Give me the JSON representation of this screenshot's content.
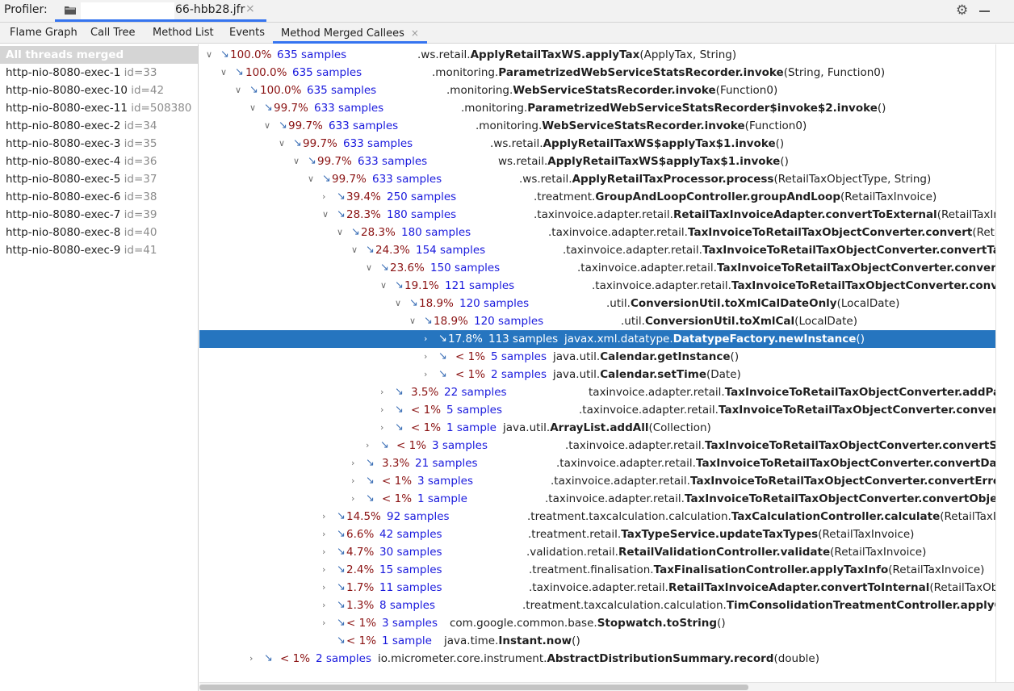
{
  "header": {
    "label": "Profiler:",
    "file_name": "66-hbb28.jfr",
    "close_glyph": "×",
    "icons": [
      "folder-icon",
      "gear-icon",
      "minimize-icon"
    ]
  },
  "tabs": [
    {
      "label": "Flame Graph"
    },
    {
      "label": "Call Tree"
    },
    {
      "label": "Method List"
    },
    {
      "label": "Events"
    },
    {
      "label": "Method Merged Callees",
      "active": true,
      "close": "×"
    }
  ],
  "threads": [
    {
      "name": "All threads merged",
      "id": ""
    },
    {
      "name": "http-nio-8080-exec-1",
      "id": "id=33"
    },
    {
      "name": "http-nio-8080-exec-10",
      "id": "id=42"
    },
    {
      "name": "http-nio-8080-exec-11",
      "id": "id=508380"
    },
    {
      "name": "http-nio-8080-exec-2",
      "id": "id=34"
    },
    {
      "name": "http-nio-8080-exec-3",
      "id": "id=35"
    },
    {
      "name": "http-nio-8080-exec-4",
      "id": "id=36"
    },
    {
      "name": "http-nio-8080-exec-5",
      "id": "id=37"
    },
    {
      "name": "http-nio-8080-exec-6",
      "id": "id=38"
    },
    {
      "name": "http-nio-8080-exec-7",
      "id": "id=39"
    },
    {
      "name": "http-nio-8080-exec-8",
      "id": "id=40"
    },
    {
      "name": "http-nio-8080-exec-9",
      "id": "id=41"
    }
  ],
  "tree": [
    {
      "pct": "100.0%",
      "samples": "635 samples",
      "cls": ".ws.retail.",
      "method": "ApplyRetailTaxWS.applyTax",
      "args": "(ApplyTax, String)"
    },
    {
      "pct": "100.0%",
      "samples": "635 samples",
      "cls": ".monitoring.",
      "method": "ParametrizedWebServiceStatsRecorder.invoke",
      "args": "(String, Function0)"
    },
    {
      "pct": "100.0%",
      "samples": "635 samples",
      "cls": ".monitoring.",
      "method": "WebServiceStatsRecorder.invoke",
      "args": "(Function0)"
    },
    {
      "pct": "99.7%",
      "samples": "633 samples",
      "cls": ".monitoring.",
      "method": "ParametrizedWebServiceStatsRecorder$invoke$2.invoke",
      "args": "()"
    },
    {
      "pct": "99.7%",
      "samples": "633 samples",
      "cls": ".monitoring.",
      "method": "WebServiceStatsRecorder.invoke",
      "args": "(Function0)"
    },
    {
      "pct": "99.7%",
      "samples": "633 samples",
      "cls": ".ws.retail.",
      "method": "ApplyRetailTaxWS$applyTax$1.invoke",
      "args": "()"
    },
    {
      "pct": "99.7%",
      "samples": "633 samples",
      "cls": "ws.retail.",
      "method": "ApplyRetailTaxWS$applyTax$1.invoke",
      "args": "()"
    },
    {
      "pct": "99.7%",
      "samples": "633 samples",
      "cls": ".ws.retail.",
      "method": "ApplyRetailTaxProcessor.process",
      "args": "(RetailTaxObjectType, String)"
    },
    {
      "pct": "39.4%",
      "samples": "250 samples",
      "cls": ".treatment.",
      "method": "GroupAndLoopController.groupAndLoop",
      "args": "(RetailTaxInvoice)"
    },
    {
      "pct": "28.3%",
      "samples": "180 samples",
      "cls": ".taxinvoice.adapter.retail.",
      "method": "RetailTaxInvoiceAdapter.convertToExternal",
      "args": "(RetailTaxInvoice)"
    },
    {
      "pct": "28.3%",
      "samples": "180 samples",
      "cls": ".taxinvoice.adapter.retail.",
      "method": "TaxInvoiceToRetailTaxObjectConverter.convert",
      "args": "(RetailTaxInvoice)"
    },
    {
      "pct": "24.3%",
      "samples": "154 samples",
      "cls": ".taxinvoice.adapter.retail.",
      "method": "TaxInvoiceToRetailTaxObjectConverter.convertTaxInvoice",
      "args": ""
    },
    {
      "pct": "23.6%",
      "samples": "150 samples",
      "cls": ".taxinvoice.adapter.retail.",
      "method": "TaxInvoiceToRetailTaxObjectConverter.convertLineItems",
      "args": ""
    },
    {
      "pct": "19.1%",
      "samples": "121 samples",
      "cls": ".taxinvoice.adapter.retail.",
      "method": "TaxInvoiceToRetailTaxObjectConverter.convertLineItem",
      "args": ""
    },
    {
      "pct": "18.9%",
      "samples": "120 samples",
      "cls": ".util.",
      "method": "ConversionUtil.toXmlCalDateOnly",
      "args": "(LocalDate)"
    },
    {
      "pct": "18.9%",
      "samples": "120 samples",
      "cls": ".util.",
      "method": "ConversionUtil.toXmlCal",
      "args": "(LocalDate)"
    },
    {
      "pct": "17.8%",
      "samples": "113 samples",
      "cls": "javax.xml.datatype.",
      "method": "DatatypeFactory.newInstance",
      "args": "()"
    },
    {
      "pct": "< 1%",
      "samples": "5 samples",
      "cls": "java.util.",
      "method": "Calendar.getInstance",
      "args": "()"
    },
    {
      "pct": "< 1%",
      "samples": "2 samples",
      "cls": "java.util.",
      "method": "Calendar.setTime",
      "args": "(Date)"
    },
    {
      "pct": "3.5%",
      "samples": "22 samples",
      "cls": "taxinvoice.adapter.retail.",
      "method": "TaxInvoiceToRetailTaxObjectConverter.addParty",
      "args": ""
    },
    {
      "pct": "< 1%",
      "samples": "5 samples",
      "cls": ".taxinvoice.adapter.retail.",
      "method": "TaxInvoiceToRetailTaxObjectConverter.convertPrice",
      "args": ""
    },
    {
      "pct": "< 1%",
      "samples": "1 sample",
      "cls": "java.util.",
      "method": "ArrayList.addAll",
      "args": "(Collection)"
    },
    {
      "pct": "< 1%",
      "samples": "3 samples",
      "cls": ".taxinvoice.adapter.retail.",
      "method": "TaxInvoiceToRetailTaxObjectConverter.convertSeller",
      "args": ""
    },
    {
      "pct": "3.3%",
      "samples": "21 samples",
      "cls": ".taxinvoice.adapter.retail.",
      "method": "TaxInvoiceToRetailTaxObjectConverter.convertDate",
      "args": ""
    },
    {
      "pct": "< 1%",
      "samples": "3 samples",
      "cls": ".taxinvoice.adapter.retail.",
      "method": "TaxInvoiceToRetailTaxObjectConverter.convertErrors",
      "args": ""
    },
    {
      "pct": "< 1%",
      "samples": "1 sample",
      "cls": ".taxinvoice.adapter.retail.",
      "method": "TaxInvoiceToRetailTaxObjectConverter.convertObject",
      "args": ""
    },
    {
      "pct": "14.5%",
      "samples": "92 samples",
      "cls": ".treatment.taxcalculation.calculation.",
      "method": "TaxCalculationController.calculate",
      "args": "(RetailTaxInvoice)"
    },
    {
      "pct": "6.6%",
      "samples": "42 samples",
      "cls": ".treatment.retail.",
      "method": "TaxTypeService.updateTaxTypes",
      "args": "(RetailTaxInvoice)"
    },
    {
      "pct": "4.7%",
      "samples": "30 samples",
      "cls": ".validation.retail.",
      "method": "RetailValidationController.validate",
      "args": "(RetailTaxInvoice)"
    },
    {
      "pct": "2.4%",
      "samples": "15 samples",
      "cls": ".treatment.finalisation.",
      "method": "TaxFinalisationController.applyTaxInfo",
      "args": "(RetailTaxInvoice)"
    },
    {
      "pct": "1.7%",
      "samples": "11 samples",
      "cls": ".taxinvoice.adapter.retail.",
      "method": "RetailTaxInvoiceAdapter.convertToInternal",
      "args": "(RetailTaxObjectType)"
    },
    {
      "pct": "1.3%",
      "samples": "8 samples",
      "cls": ".treatment.taxcalculation.calculation.",
      "method": "TimConsolidationTreatmentController.applyConsolidation",
      "args": ""
    },
    {
      "pct": "< 1%",
      "samples": "3 samples",
      "cls": "com.google.common.base.",
      "method": "Stopwatch.toString",
      "args": "()"
    },
    {
      "pct": "< 1%",
      "samples": "1 sample",
      "cls": "java.time.",
      "method": "Instant.now",
      "args": "()"
    },
    {
      "pct": "< 1%",
      "samples": "2 samples",
      "cls": "io.micrometer.core.instrument.",
      "method": "AbstractDistributionSummary.record",
      "args": "(double)"
    }
  ],
  "selected_row": 16
}
